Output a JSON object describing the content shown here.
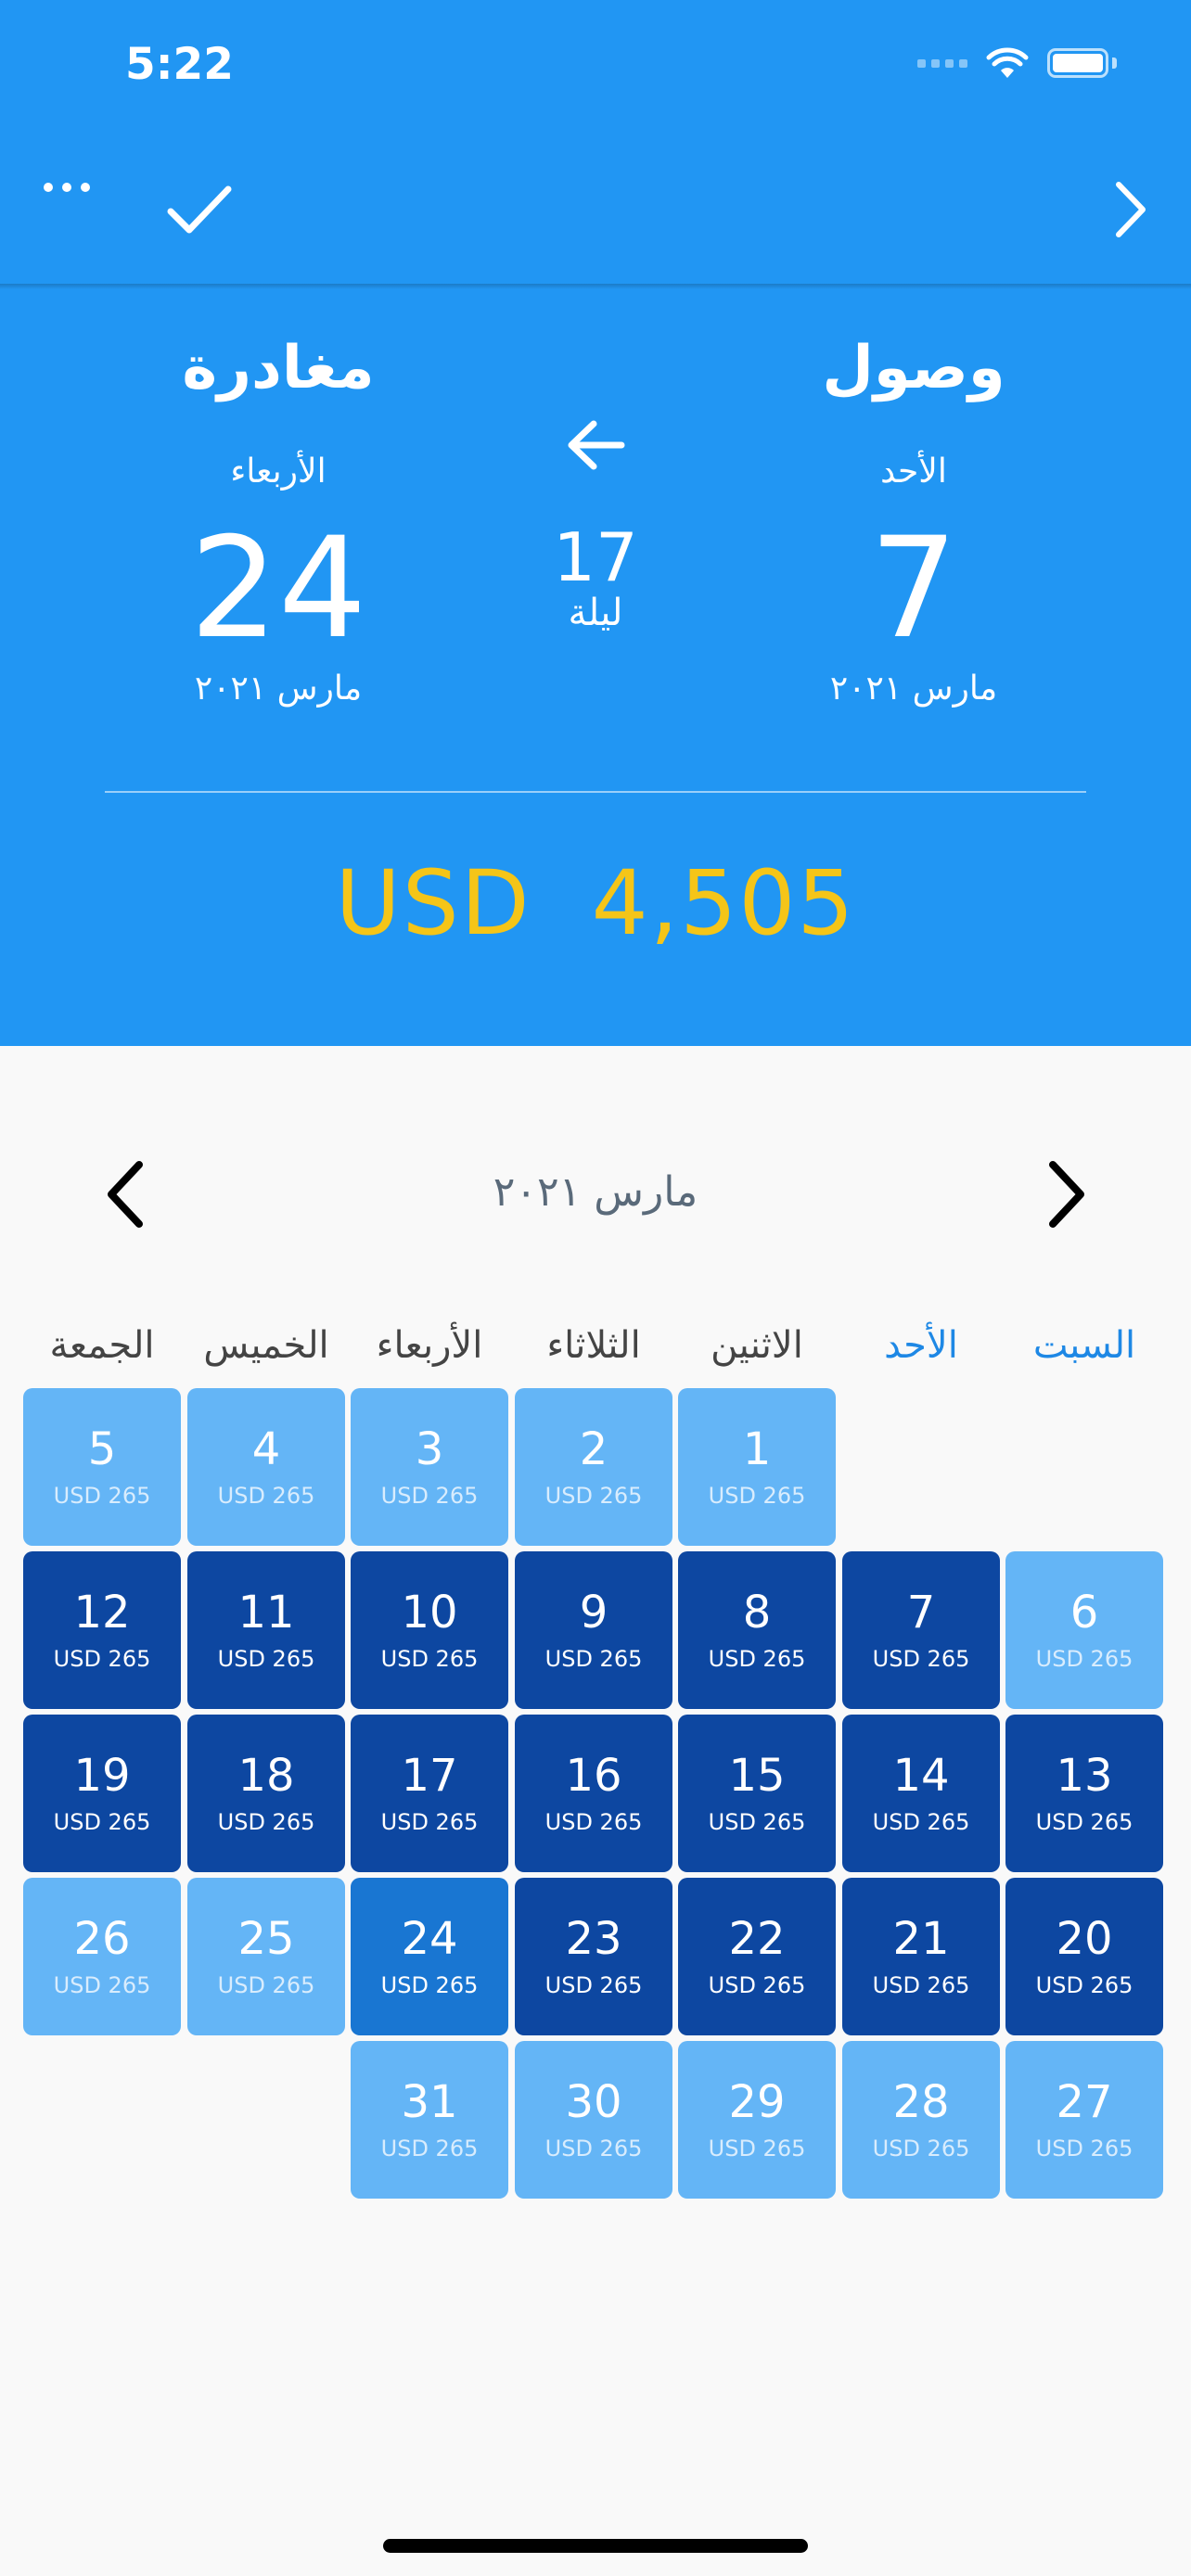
{
  "status": {
    "time": "5:22"
  },
  "appbar": {
    "more_icon": "more-dots-icon",
    "confirm_icon": "checkmark-icon",
    "next_icon": "chevron-right-icon"
  },
  "stay": {
    "arrival": {
      "label": "وصول",
      "day_name": "الأحد",
      "day": "7",
      "month_year": "مارس ٢٠٢١"
    },
    "departure": {
      "label": "مغادرة",
      "day_name": "الأربعاء",
      "day": "24",
      "month_year": "مارس ٢٠٢١"
    },
    "nights": {
      "count": "17",
      "label": "ليلة"
    },
    "total_price": "USD  4,505"
  },
  "calendar": {
    "month_title": "مارس ٢٠٢١",
    "weekdays": [
      "السبت",
      "الأحد",
      "الاثنين",
      "الثلاثاء",
      "الأربعاء",
      "الخميس",
      "الجمعة"
    ],
    "weekend_indices": [
      0,
      1
    ],
    "price_label": "USD 265",
    "first_day_column": 2,
    "days_in_month": 31,
    "selected_range": [
      7,
      24
    ],
    "selected_start": 7,
    "selected_end": 24
  },
  "colors": {
    "header_blue": "#2196f3",
    "price_yellow": "#f5c518",
    "available": "#64b5f6",
    "selected": "#0d47a1",
    "selected_end": "#1976d2"
  }
}
